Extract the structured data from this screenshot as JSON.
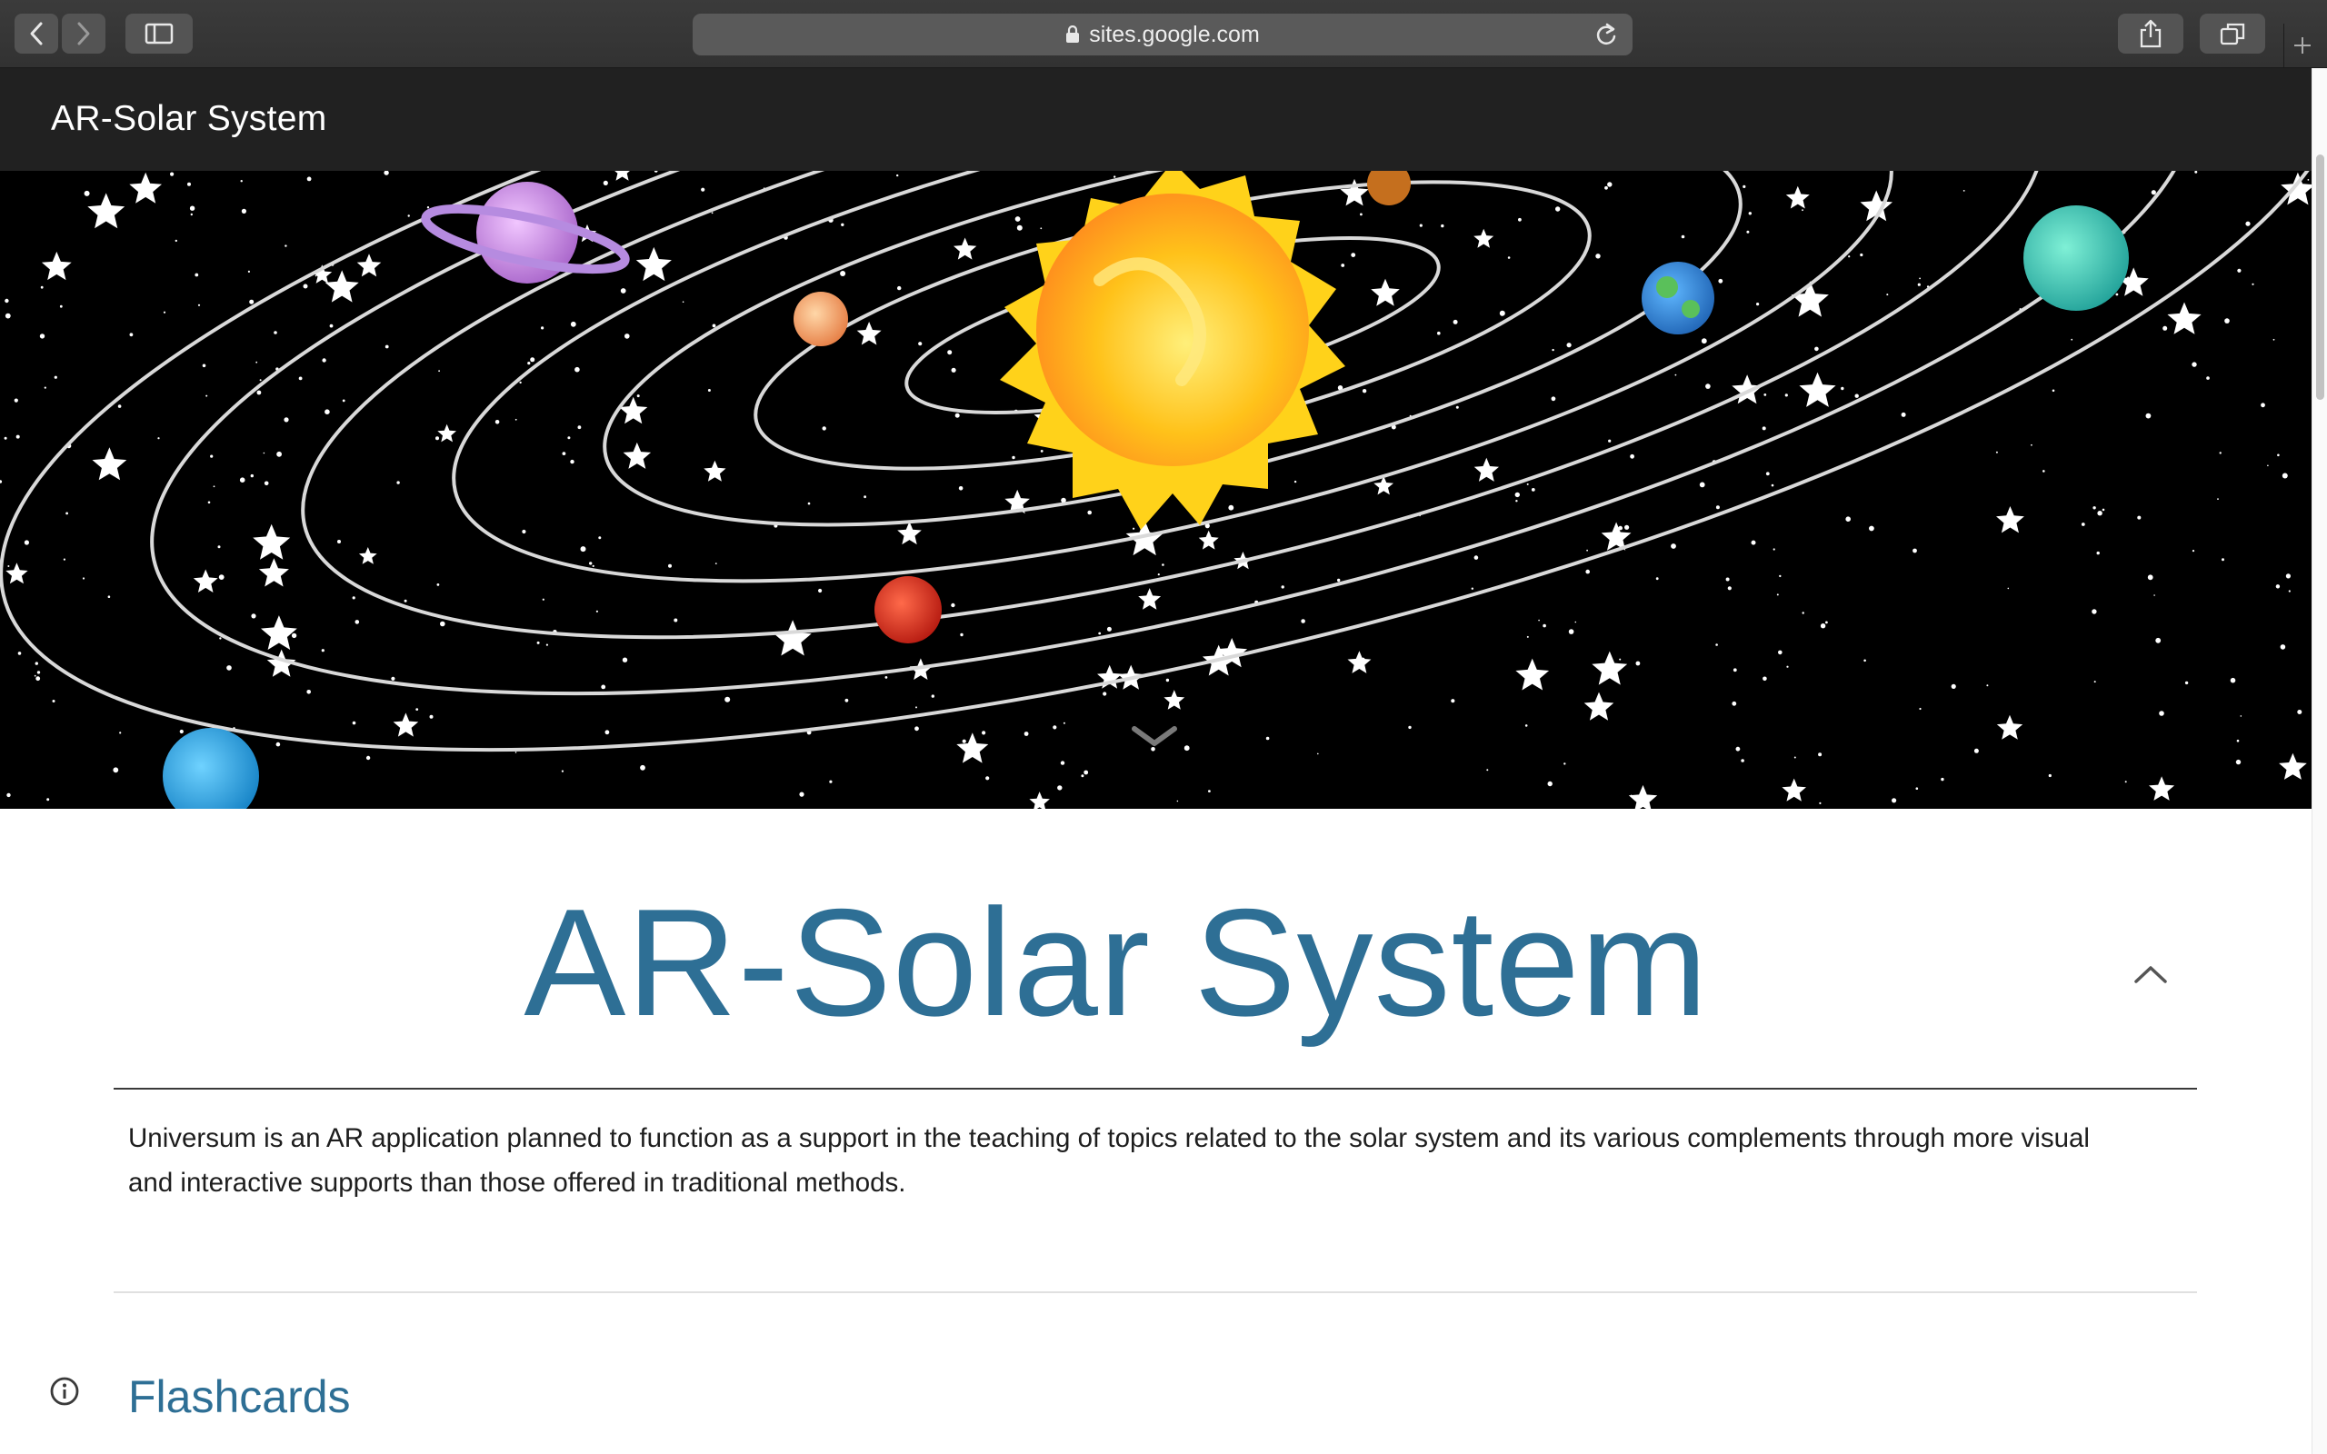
{
  "browser": {
    "url": "sites.google.com",
    "icons": [
      "back-icon",
      "forward-icon",
      "sidebar-icon",
      "lock-icon",
      "reload-icon",
      "share-icon",
      "tabs-icon",
      "new-tab-icon"
    ]
  },
  "site": {
    "header_title": "AR-Solar System"
  },
  "hero": {
    "icons": [
      "scroll-down-chevron-icon"
    ]
  },
  "main": {
    "page_title": "AR-Solar System",
    "description": "Universum is an AR application planned to function as a support in the teaching of topics related to the solar system and its various complements through more visual and interactive supports than those offered in traditional methods.",
    "section_title": "Flashcards"
  },
  "colors": {
    "toolbar": "#353535",
    "header": "#212121",
    "accent": "#2e6f95",
    "sun": "#ffc21a"
  }
}
